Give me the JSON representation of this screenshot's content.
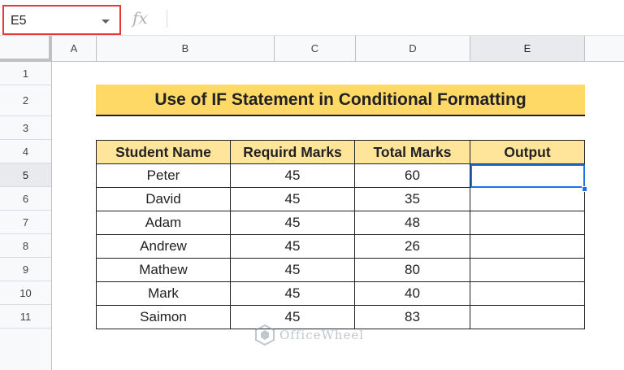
{
  "name_box": {
    "value": "E5"
  },
  "formula_bar": {
    "fx_label": "fx",
    "value": ""
  },
  "columns": [
    "A",
    "B",
    "C",
    "D",
    "E"
  ],
  "active_column": "E",
  "rows": [
    "1",
    "2",
    "3",
    "4",
    "5",
    "6",
    "7",
    "8",
    "9",
    "10",
    "11"
  ],
  "active_row": "5",
  "title": "Use of IF Statement in Conditional Formatting",
  "table": {
    "headers": [
      "Student Name",
      "Requird Marks",
      "Total Marks",
      "Output"
    ],
    "rows": [
      [
        "Peter",
        "45",
        "60",
        ""
      ],
      [
        "David",
        "45",
        "35",
        ""
      ],
      [
        "Adam",
        "45",
        "48",
        ""
      ],
      [
        "Andrew",
        "45",
        "26",
        ""
      ],
      [
        "Mathew",
        "45",
        "80",
        ""
      ],
      [
        "Mark",
        "45",
        "40",
        ""
      ],
      [
        "Saimon",
        "45",
        "83",
        ""
      ]
    ]
  },
  "watermark": {
    "text": "OfficeWheel"
  },
  "colors": {
    "title_fill": "#ffd966",
    "header_fill": "#ffe599",
    "selection": "#1a73e8",
    "name_box_border": "#e53935"
  }
}
